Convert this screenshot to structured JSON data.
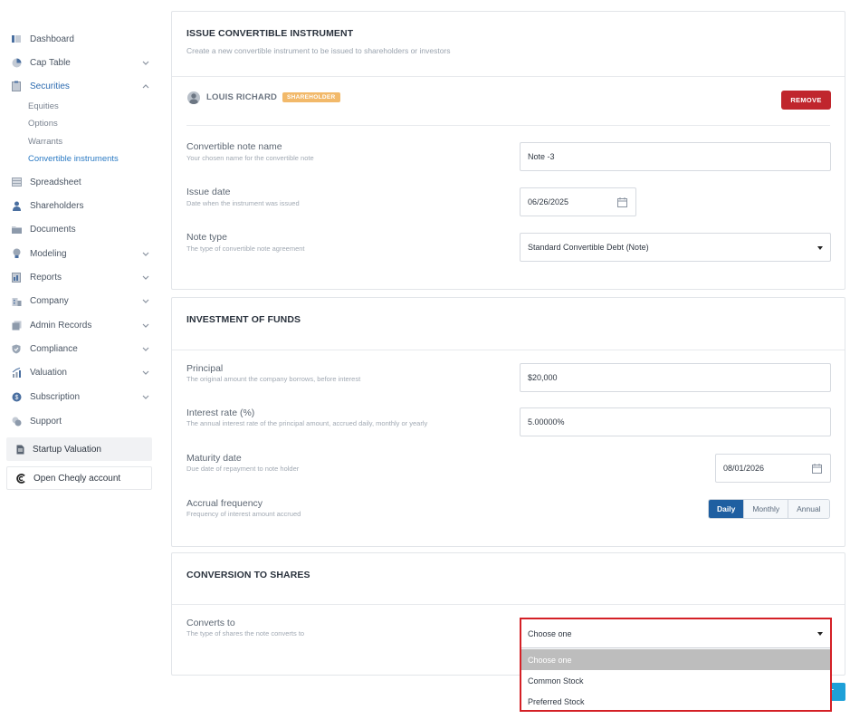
{
  "sidebar": {
    "items": [
      {
        "label": "Dashboard",
        "icon": "dashboard-icon"
      },
      {
        "label": "Cap Table",
        "icon": "pie-chart-icon"
      },
      {
        "label": "Securities",
        "icon": "clipboard-icon"
      },
      {
        "label": "Spreadsheet",
        "icon": "spreadsheet-icon"
      },
      {
        "label": "Shareholders",
        "icon": "person-icon"
      },
      {
        "label": "Documents",
        "icon": "folder-icon"
      },
      {
        "label": "Modeling",
        "icon": "lightbulb-icon"
      },
      {
        "label": "Reports",
        "icon": "report-icon"
      },
      {
        "label": "Company",
        "icon": "building-icon"
      },
      {
        "label": "Admin Records",
        "icon": "records-icon"
      },
      {
        "label": "Compliance",
        "icon": "shield-check-icon"
      },
      {
        "label": "Valuation",
        "icon": "chart-growth-icon"
      },
      {
        "label": "Subscription",
        "icon": "dollar-circle-icon"
      },
      {
        "label": "Support",
        "icon": "support-icon"
      }
    ],
    "securities_sub": [
      "Equities",
      "Options",
      "Warrants",
      "Convertible instruments"
    ],
    "startup_valuation": "Startup Valuation",
    "open_account": "Open Cheqly account"
  },
  "issue": {
    "title": "ISSUE CONVERTIBLE INSTRUMENT",
    "subtitle": "Create a new convertible instrument to be issued to shareholders or investors",
    "holder_name": "LOUIS RICHARD",
    "holder_badge": "SHAREHOLDER",
    "remove_label": "REMOVE",
    "note_name_label": "Convertible note name",
    "note_name_help": "Your chosen name for the convertible note",
    "note_name_value": "Note -3",
    "issue_date_label": "Issue date",
    "issue_date_help": "Date when the instrument was issued",
    "issue_date_value": "06/26/2025",
    "note_type_label": "Note type",
    "note_type_help": "The type of convertible note agreement",
    "note_type_value": "Standard Convertible Debt (Note)"
  },
  "investment": {
    "title": "INVESTMENT OF FUNDS",
    "principal_label": "Principal",
    "principal_help": "The original amount the company borrows, before interest",
    "principal_value": "$20,000",
    "rate_label": "Interest rate (%)",
    "rate_help": "The annual interest rate of the principal amount, accrued daily, monthly or yearly",
    "rate_value": "5.00000%",
    "maturity_label": "Maturity date",
    "maturity_help": "Due date of repayment to note holder",
    "maturity_value": "08/01/2026",
    "accrual_label": "Accrual frequency",
    "accrual_help": "Frequency of interest amount accrued",
    "accrual_options": [
      "Daily",
      "Monthly",
      "Annual"
    ]
  },
  "conversion": {
    "title": "CONVERSION TO SHARES",
    "converts_label": "Converts to",
    "converts_help": "The type of shares the note converts to",
    "selected": "Choose one",
    "options": [
      "Choose one",
      "Common Stock",
      "Preferred Stock"
    ]
  },
  "footer": {
    "partial_button_label": "T"
  }
}
